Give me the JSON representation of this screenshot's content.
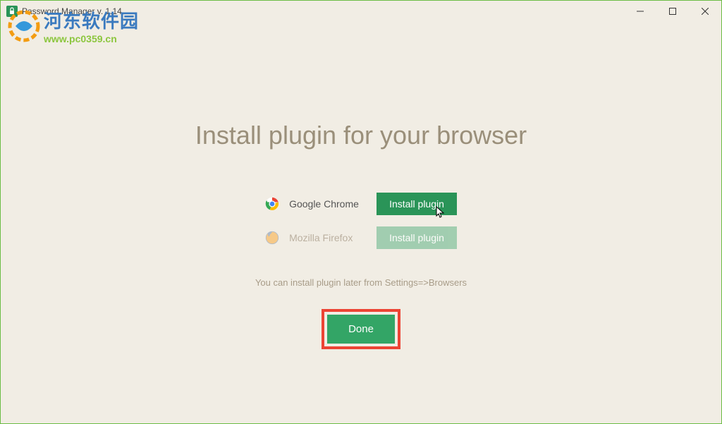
{
  "window": {
    "title": "Password Manager v. 1.14"
  },
  "heading": "Install plugin for your browser",
  "browsers": [
    {
      "name": "Google Chrome",
      "button_label": "Install plugin"
    },
    {
      "name": "Mozilla Firefox",
      "button_label": "Install plugin"
    }
  ],
  "hint": "You can install plugin later from Settings=>Browsers",
  "done_label": "Done",
  "watermark": {
    "title": "河东软件园",
    "url": "www.pc0359.cn"
  }
}
